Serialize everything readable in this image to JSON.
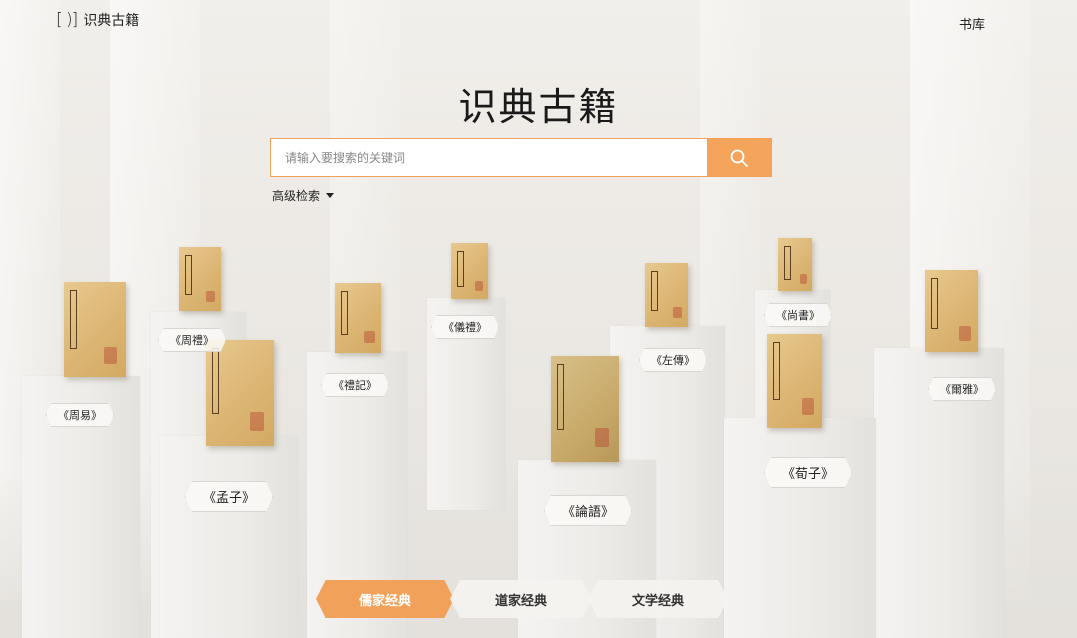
{
  "header": {
    "logo_mark": "[ )]",
    "logo_text": "识典古籍",
    "nav_library": "书库"
  },
  "main": {
    "title": "识典古籍",
    "search": {
      "placeholder": "请输入要搜索的关键词",
      "value": ""
    },
    "advanced_search": "高级检索"
  },
  "books": [
    {
      "title": "《周易》"
    },
    {
      "title": "《周禮》"
    },
    {
      "title": "《孟子》"
    },
    {
      "title": "《禮記》"
    },
    {
      "title": "《儀禮》"
    },
    {
      "title": "《論語》"
    },
    {
      "title": "《左傳》"
    },
    {
      "title": "《尚書》"
    },
    {
      "title": "《荀子》"
    },
    {
      "title": "《爾雅》"
    }
  ],
  "tabs": [
    {
      "label": "儒家经典",
      "active": true
    },
    {
      "label": "道家经典",
      "active": false
    },
    {
      "label": "文学经典",
      "active": false
    }
  ],
  "colors": {
    "accent": "#f5a45c",
    "search_border": "#f0a05a"
  }
}
